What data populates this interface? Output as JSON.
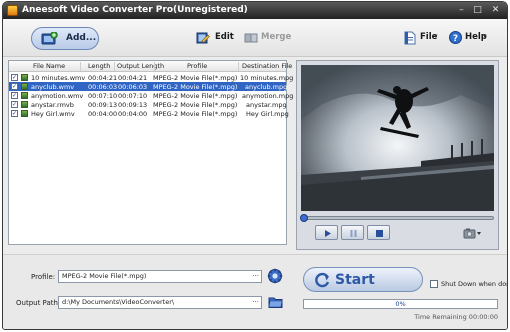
{
  "window": {
    "title": "Aneesoft Video Converter Pro(Unregistered)",
    "controls": {
      "minimize": "–",
      "maximize": "□",
      "close": "✕"
    }
  },
  "toolbar": {
    "add_label": "Add...",
    "edit_label": "Edit",
    "merge_label": "Merge",
    "file_label": "File",
    "help_label": "Help",
    "dropdown_glyph": "▾"
  },
  "file_list": {
    "columns": [
      "File Name",
      "Length",
      "Output Length",
      "Profile",
      "Destination File"
    ],
    "check_glyph": "✓",
    "selected_row": 1,
    "rows": [
      {
        "name": "10 minutes.wmv",
        "length": "00:04:21",
        "output_length": "00:04:21",
        "profile": "MPEG-2 Movie File(*.mpg)",
        "destination": "10 minutes.mpg",
        "checked": true
      },
      {
        "name": "anyclub.wmv",
        "length": "00:06:03",
        "output_length": "00:06:03",
        "profile": "MPEG-2 Movie File(*.mpg)",
        "destination": "anyclub.mpg",
        "checked": true
      },
      {
        "name": "anymotion.wmv",
        "length": "00:07:10",
        "output_length": "00:07:10",
        "profile": "MPEG-2 Movie File(*.mpg)",
        "destination": "anymotion.mpg",
        "checked": true
      },
      {
        "name": "anystar.rmvb",
        "length": "00:09:13",
        "output_length": "00:09:13",
        "profile": "MPEG-2 Movie File(*.mpg)",
        "destination": "anystar.mpg",
        "checked": true
      },
      {
        "name": "Hey Girl.wmv",
        "length": "00:04:00",
        "output_length": "00:04:00",
        "profile": "MPEG-2 Movie File(*.mpg)",
        "destination": "Hey Girl.mpg",
        "checked": true
      }
    ]
  },
  "preview": {
    "seek_position": 0,
    "buttons": [
      "play",
      "pause",
      "stop",
      "snapshot"
    ]
  },
  "output": {
    "profile_label": "Profile:",
    "profile_value": "MPEG-2 Movie File(*.mpg)",
    "path_label": "Output Path:",
    "path_value": "d:\\My Documents\\VideoConverter\\",
    "more_glyph": "···"
  },
  "convert": {
    "start_label": "Start",
    "shutdown_label": "Shut Down when done",
    "shutdown_checked": false,
    "progress_text": "0%",
    "progress_value": 0,
    "time_remaining": "Time Remaining 00:00:00"
  },
  "colors": {
    "selection": "#3165c4",
    "accent_blue": "#2d59a8",
    "titlebar": "#222222"
  }
}
